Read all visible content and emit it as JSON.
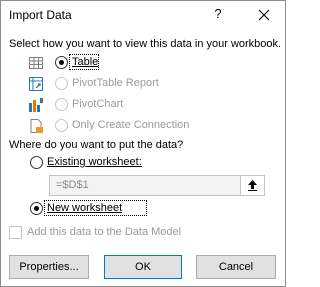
{
  "title": "Import Data",
  "titlebar": {
    "help_label": "?"
  },
  "view_section": {
    "heading": "Select how you want to view this data in your workbook.",
    "options": [
      {
        "label": "Table",
        "selected": true,
        "enabled": true,
        "icon": "table-icon"
      },
      {
        "label": "PivotTable Report",
        "selected": false,
        "enabled": false,
        "icon": "pivottable-icon"
      },
      {
        "label": "PivotChart",
        "selected": false,
        "enabled": false,
        "icon": "pivotchart-icon"
      },
      {
        "label": "Only Create Connection",
        "selected": false,
        "enabled": false,
        "icon": "connection-icon"
      }
    ]
  },
  "destination_section": {
    "heading": "Where do you want to put the data?",
    "existing_label": "Existing worksheet:",
    "existing_selected": false,
    "range_value": "=$D$1",
    "new_label": "New worksheet",
    "new_selected": true
  },
  "data_model": {
    "label": "Add this data to the Data Model",
    "checked": false,
    "enabled": false
  },
  "buttons": {
    "properties": "Properties...",
    "ok": "OK",
    "cancel": "Cancel"
  },
  "colors": {
    "accent": "#0078d7",
    "disabled_text": "#9b9b9b",
    "button_face": "#e1e1e1"
  }
}
